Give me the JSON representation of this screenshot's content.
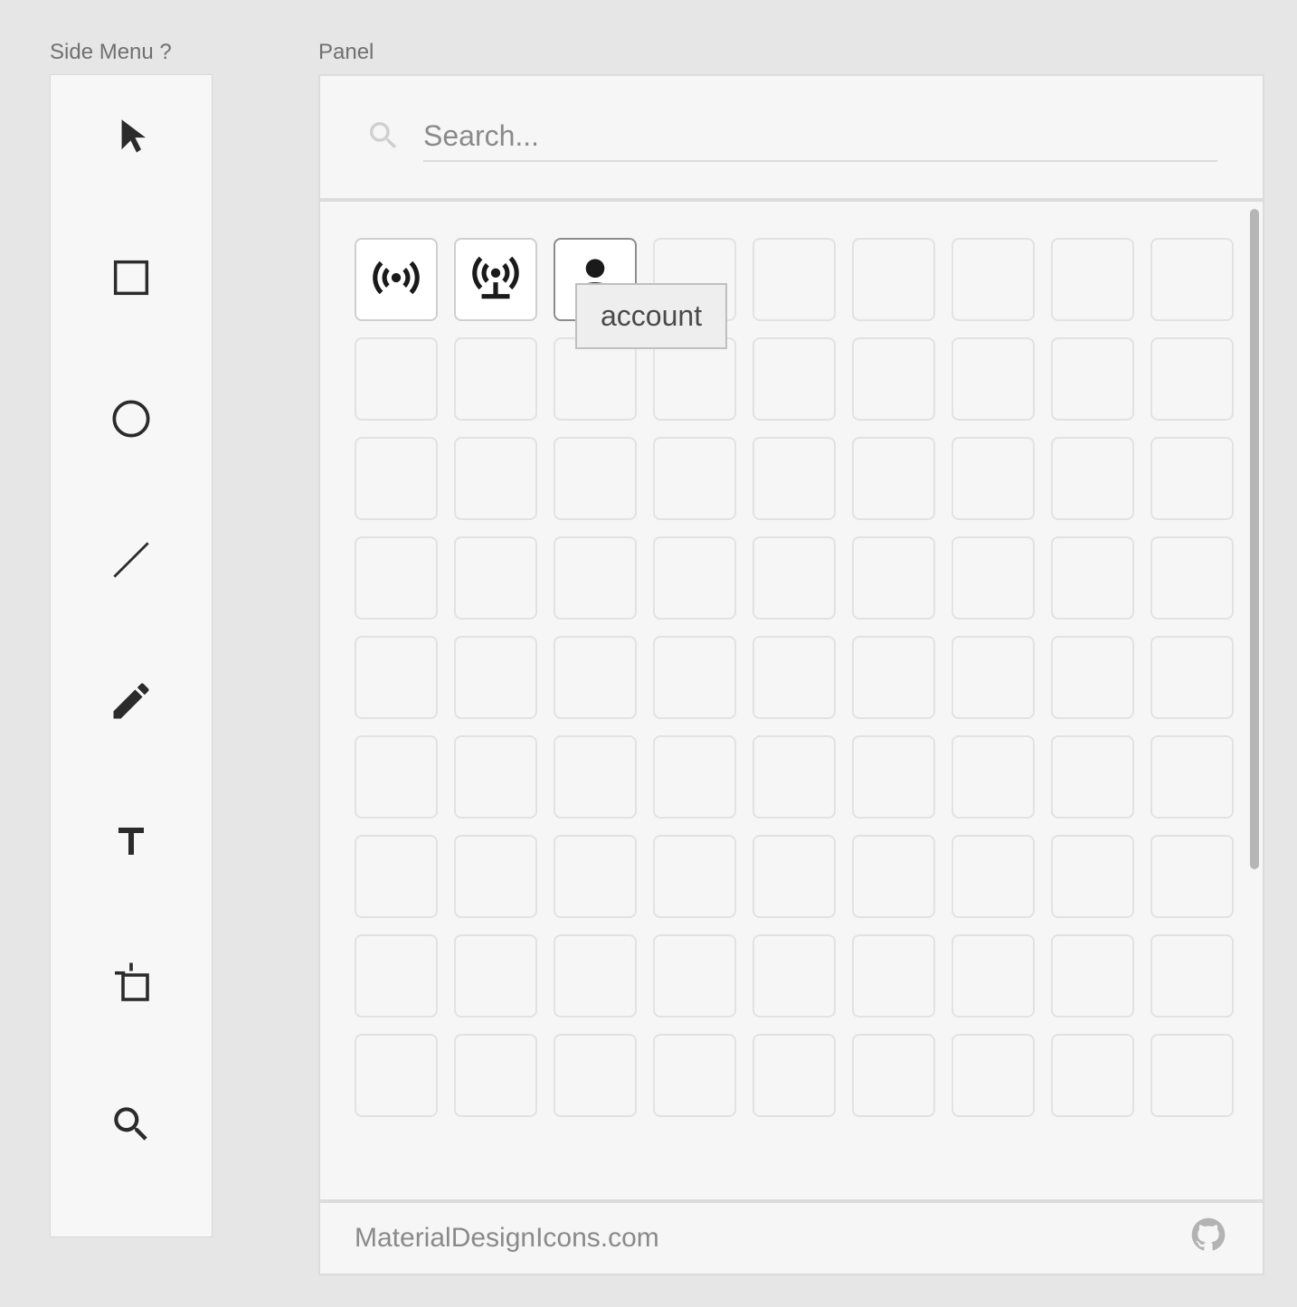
{
  "labels": {
    "side_menu": "Side Menu ?",
    "panel": "Panel"
  },
  "side_menu": {
    "tools": [
      {
        "id": "pointer",
        "icon": "pointer-icon"
      },
      {
        "id": "rectangle",
        "icon": "square-icon"
      },
      {
        "id": "ellipse",
        "icon": "circle-icon"
      },
      {
        "id": "line",
        "icon": "line-icon"
      },
      {
        "id": "pen",
        "icon": "pen-icon"
      },
      {
        "id": "text",
        "icon": "text-icon"
      },
      {
        "id": "artboard",
        "icon": "artboard-icon"
      },
      {
        "id": "zoom",
        "icon": "magnify-icon"
      }
    ]
  },
  "panel": {
    "search": {
      "placeholder": "Search..."
    },
    "grid": {
      "columns": 9,
      "rows": 9,
      "icons": [
        {
          "index": 0,
          "name": "access-point",
          "tooltip": "access-point"
        },
        {
          "index": 1,
          "name": "access-point-network",
          "tooltip": "access-point-network"
        },
        {
          "index": 2,
          "name": "account",
          "tooltip": "account",
          "hovered": true
        }
      ],
      "tooltip_visible": "account"
    },
    "footer": {
      "link_text": "MaterialDesignIcons.com",
      "github_icon": "github-icon"
    }
  }
}
